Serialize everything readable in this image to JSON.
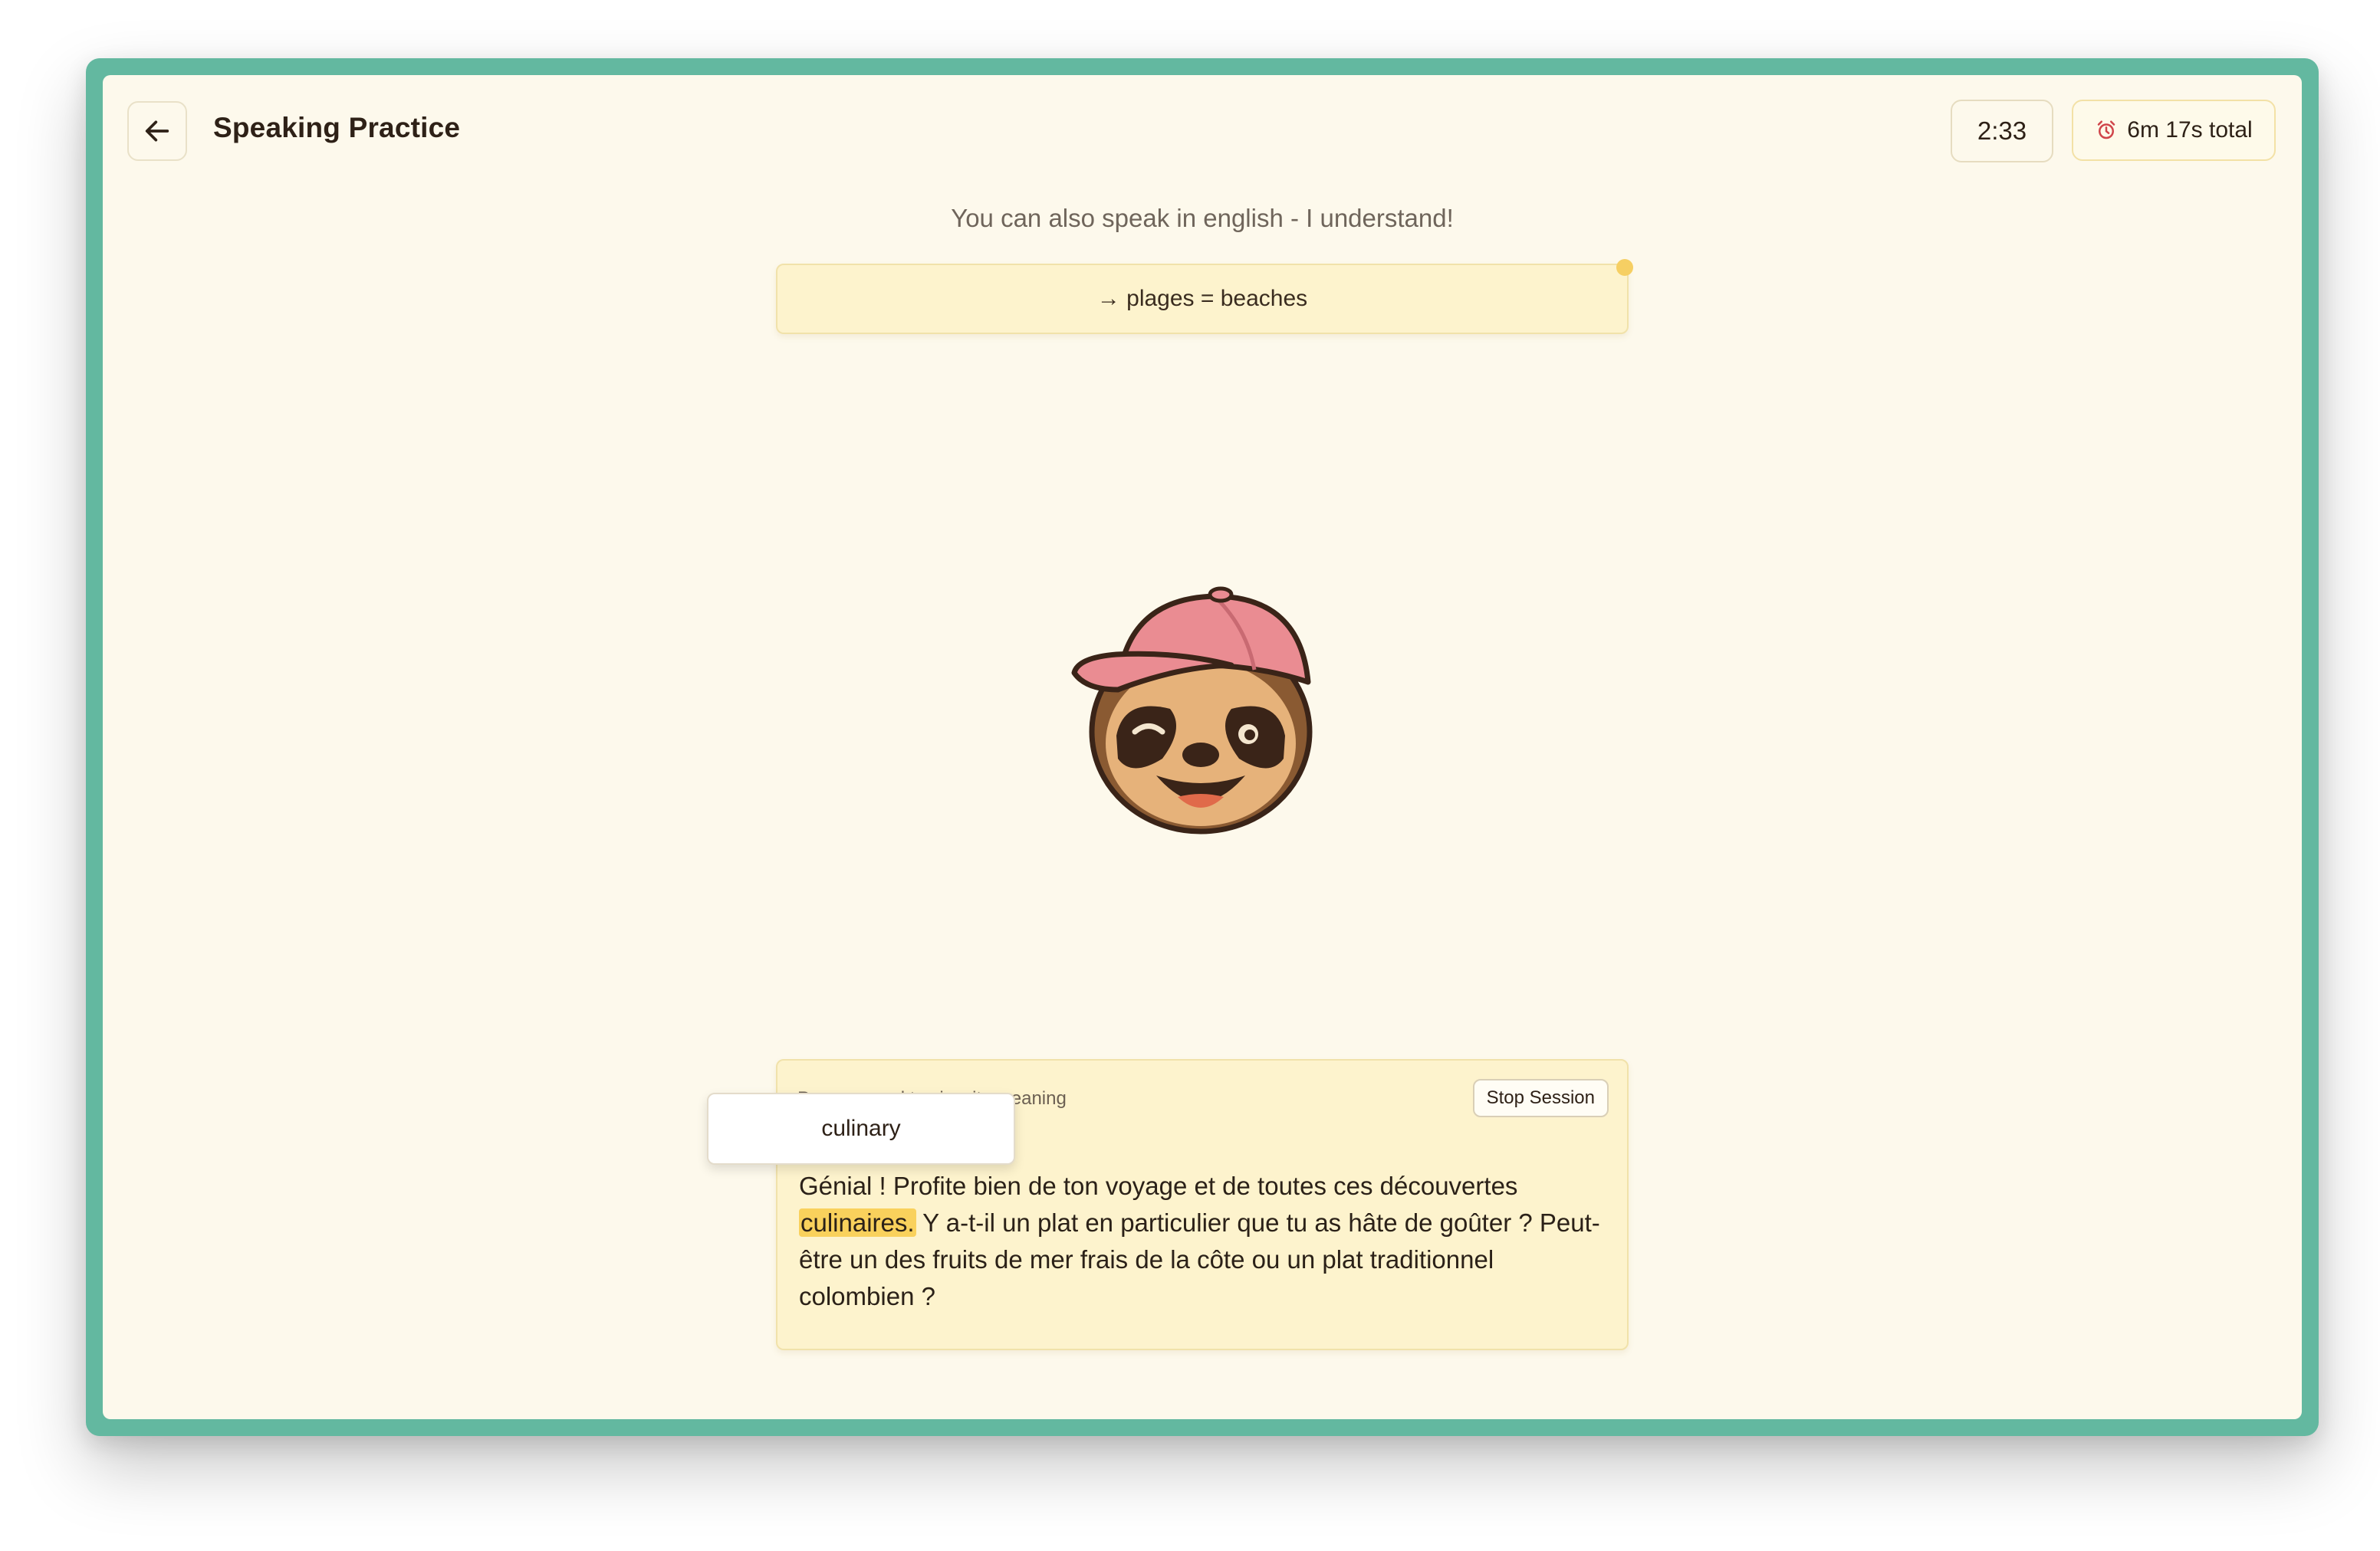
{
  "header": {
    "title": "Speaking Practice",
    "timer": "2:33",
    "total_time": "6m 17s total"
  },
  "hint": "You can also speak in english - I understand!",
  "vocab_card": {
    "text": "→ plages = beaches"
  },
  "transcript": {
    "instruction": "Press a word to view its meaning",
    "stop_label": "Stop Session",
    "line_start": "Génial ! Profite bien de ton voyage et de toutes ces découvertes",
    "highlighted_word": "culinaires.",
    "line_rest": " Y a-t-il un plat en particulier que tu as hâte de goûter ? Peut-être un des fruits de mer frais de la côte ou un plat traditionnel colombien ?"
  },
  "tooltip": {
    "translation": "culinary"
  },
  "icons": {
    "back": "arrow-left-icon",
    "alarm": "alarm-clock-icon",
    "mascot": "sloth-with-cap"
  },
  "colors": {
    "frame": "#63b8a0",
    "background": "#fdf9ec",
    "card": "#fdf3cd",
    "highlight": "#f9d15c",
    "cap": "#ea8c92"
  }
}
